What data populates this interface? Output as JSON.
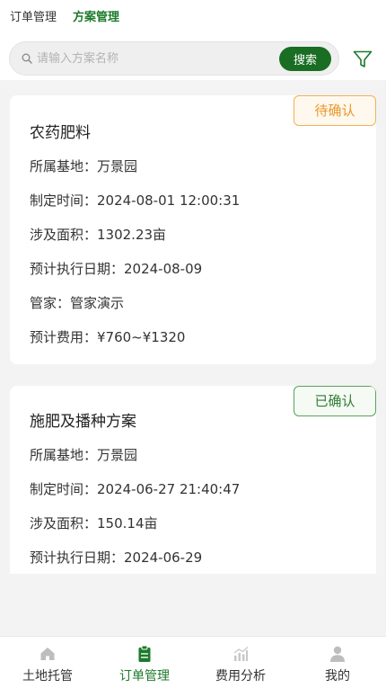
{
  "top_tabs": [
    {
      "label": "订单管理"
    },
    {
      "label": "方案管理"
    }
  ],
  "search": {
    "placeholder": "请输入方案名称",
    "button_label": "搜索"
  },
  "icons": {
    "search": "search-icon",
    "filter": "filter-icon",
    "nav": [
      "home-icon",
      "clipboard-icon",
      "chart-icon",
      "user-icon"
    ]
  },
  "colors": {
    "accent": "#1d7a2b",
    "search_button": "#1a6e23",
    "pending_badge": "#e9982a",
    "confirmed_badge": "#2f7d33",
    "background": "#f3f3f3"
  },
  "cards": [
    {
      "status": "待确认",
      "title": "农药肥料",
      "base": "所属基地：万景园",
      "created": "制定时间：2024-08-01 12:00:31",
      "area": "涉及面积：1302.23亩",
      "exec_date": "预计执行日期：2024-08-09",
      "manager": "管家：管家演示",
      "cost": "预计费用：¥760~¥1320"
    },
    {
      "status": "已确认",
      "title": "施肥及播种方案",
      "base": "所属基地：万景园",
      "created": "制定时间：2024-06-27 21:40:47",
      "area": "涉及面积：150.14亩",
      "exec_date": "预计执行日期：2024-06-29"
    }
  ],
  "bottom_nav": [
    {
      "label": "土地托管"
    },
    {
      "label": "订单管理"
    },
    {
      "label": "费用分析"
    },
    {
      "label": "我的"
    }
  ]
}
